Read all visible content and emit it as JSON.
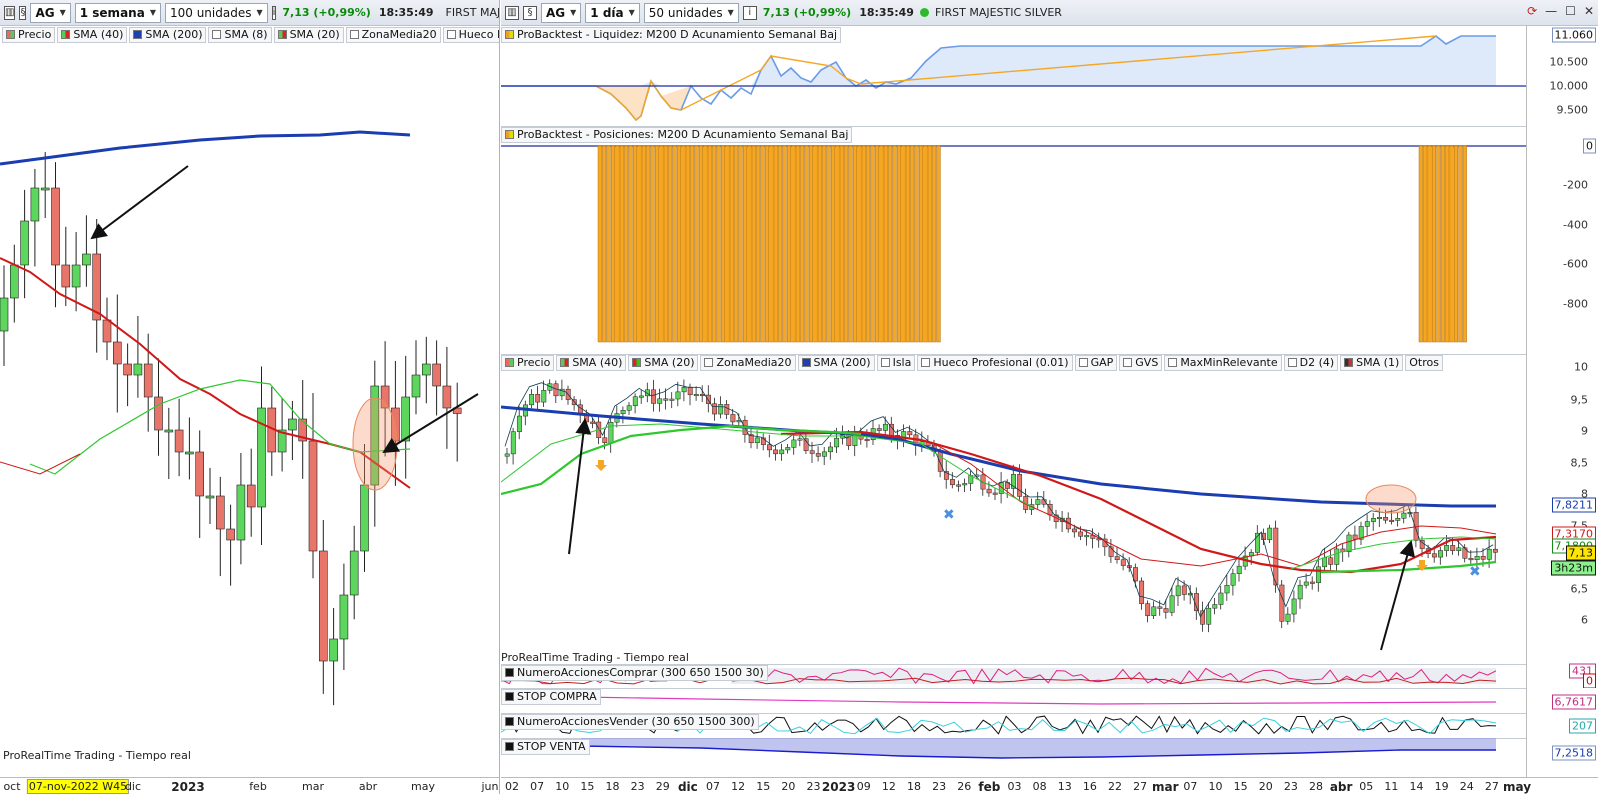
{
  "left": {
    "toolbar": {
      "symbol": "AG",
      "period": "1 semana",
      "units": "100 unidades",
      "price": "7,13 (+0,99%)",
      "time": "18:35:49",
      "name": "FIRST MAJEST"
    },
    "legend": [
      "Precio",
      "SMA (40)",
      "SMA (200)",
      "SMA (8)",
      "SMA (20)",
      "ZonaMedia20",
      "Hueco Profesional"
    ],
    "footer": "ProRealTime Trading - Tiempo real",
    "xaxis": [
      "oct",
      "07-nov-2022 W45",
      "dic",
      "2023",
      "feb",
      "mar",
      "abr",
      "may",
      "jun"
    ]
  },
  "right": {
    "toolbar": {
      "symbol": "AG",
      "period": "1 día",
      "units": "50 unidades",
      "price": "7,13 (+0,99%)",
      "time": "18:35:49",
      "name": "FIRST MAJESTIC SILVER"
    },
    "liquidez": {
      "label": "ProBacktest - Liquidez: M200 D Acunamiento Semanal Baj",
      "ticks": [
        "11.060",
        "10.500",
        "10.000",
        "9.500"
      ]
    },
    "posiciones": {
      "label": "ProBacktest - Posiciones: M200 D Acunamiento Semanal Baj",
      "ticks": [
        "0",
        "-200",
        "-400",
        "-600",
        "-800"
      ]
    },
    "legend": [
      "Precio",
      "SMA (40)",
      "SMA (20)",
      "ZonaMedia20",
      "SMA (200)",
      "Isla",
      "Hueco Profesional (0.01)",
      "GAP",
      "GVS",
      "MaxMinRelevante",
      "D2 (4)",
      "SMA (1)",
      "Otros"
    ],
    "price_ticks": [
      "10",
      "9,5",
      "9",
      "8,5",
      "8",
      "7,5",
      "7",
      "6,5",
      "6"
    ],
    "price_tags": {
      "sma200": "7,8211",
      "sma40": "7,3170",
      "sma20": "7,1800",
      "last": "7,13",
      "countdown": "3h23m"
    },
    "footer": "ProRealTime Trading - Tiempo real",
    "ind1": {
      "label": "NumeroAccionesComprar (300 650 1500 30)",
      "tags": [
        "431",
        "0"
      ]
    },
    "ind2": {
      "label": "STOP COMPRA",
      "tag": "6,7617"
    },
    "ind3": {
      "label": "NumeroAccionesVender (30 650 1500 300)",
      "tag": "207"
    },
    "ind4": {
      "label": "STOP VENTA",
      "tag": "7,2518"
    },
    "xaxis": [
      "02",
      "07",
      "10",
      "15",
      "18",
      "23",
      "29",
      "dic",
      "07",
      "12",
      "15",
      "20",
      "23",
      "2023",
      "09",
      "12",
      "18",
      "23",
      "26",
      "feb",
      "03",
      "08",
      "13",
      "16",
      "22",
      "27",
      "mar",
      "07",
      "10",
      "15",
      "20",
      "23",
      "28",
      "abr",
      "05",
      "11",
      "14",
      "19",
      "24",
      "27",
      "may"
    ]
  },
  "colors": {
    "up": "#5cd65c",
    "down": "#e8756a",
    "sma40": "#d01818",
    "sma200": "#1a3db0",
    "zona": "#2ec82e",
    "orange": "#f5a623"
  }
}
